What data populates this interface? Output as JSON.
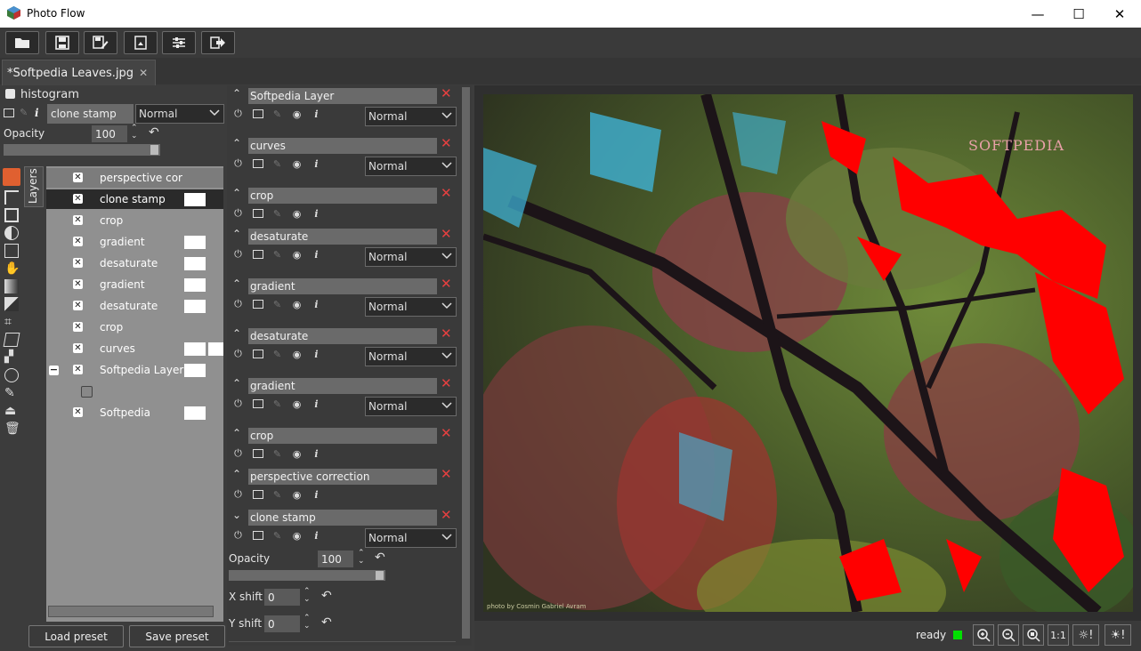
{
  "window": {
    "title": "Photo Flow",
    "minimize": "—",
    "maximize": "☐",
    "close": "✕"
  },
  "toolbar": {
    "buttons": [
      "open-folder-icon",
      "save-icon",
      "save-as-icon",
      "export-icon",
      "settings-sliders-icon",
      "exit-icon"
    ]
  },
  "tab": {
    "label": "*Softpedia Leaves.jpg",
    "close": "✕"
  },
  "left": {
    "histogram_label": "histogram",
    "layer_name": "clone stamp",
    "blend_mode": "Normal",
    "opacity_label": "Opacity",
    "opacity_value": "100",
    "layers_tab": "Layers",
    "layers": [
      {
        "name": "perspective cor"
      },
      {
        "name": "clone stamp"
      },
      {
        "name": "crop"
      },
      {
        "name": "gradient"
      },
      {
        "name": "desaturate"
      },
      {
        "name": "gradient"
      },
      {
        "name": "desaturate"
      },
      {
        "name": "crop"
      },
      {
        "name": "curves"
      },
      {
        "name": "Softpedia Layer"
      },
      {
        "name": ""
      },
      {
        "name": "Softpedia"
      }
    ],
    "load_preset": "Load preset",
    "save_preset": "Save preset"
  },
  "middle": {
    "blocks": [
      {
        "title": "Softpedia Layer",
        "blend": "Normal",
        "expanded": false
      },
      {
        "title": "curves",
        "blend": "Normal",
        "expanded": false
      },
      {
        "title": "crop",
        "blend": "",
        "expanded": false
      },
      {
        "title": "desaturate",
        "blend": "Normal",
        "expanded": false
      },
      {
        "title": "gradient",
        "blend": "Normal",
        "expanded": false
      },
      {
        "title": "desaturate",
        "blend": "Normal",
        "expanded": false
      },
      {
        "title": "gradient",
        "blend": "Normal",
        "expanded": false
      },
      {
        "title": "crop",
        "blend": "",
        "expanded": false
      },
      {
        "title": "perspective correction",
        "blend": "",
        "expanded": false
      },
      {
        "title": "clone stamp",
        "blend": "Normal",
        "expanded": true
      }
    ],
    "opacity_label": "Opacity",
    "opacity_value": "100",
    "xshift_label": "X shift",
    "xshift_value": "0",
    "yshift_label": "Y shift",
    "yshift_value": "0"
  },
  "image": {
    "watermark": "SOFTPEDIA",
    "credit": "photo by Cosmin Gabriel Avram"
  },
  "status": {
    "text": "ready",
    "indicator_color": "#00e000",
    "zoom_buttons": [
      "zoom-in-icon",
      "zoom-out-icon",
      "zoom-fit-icon"
    ],
    "one_to_one": "1:1",
    "shadows_warning": "☼!",
    "highlights_warning": "☀!"
  }
}
